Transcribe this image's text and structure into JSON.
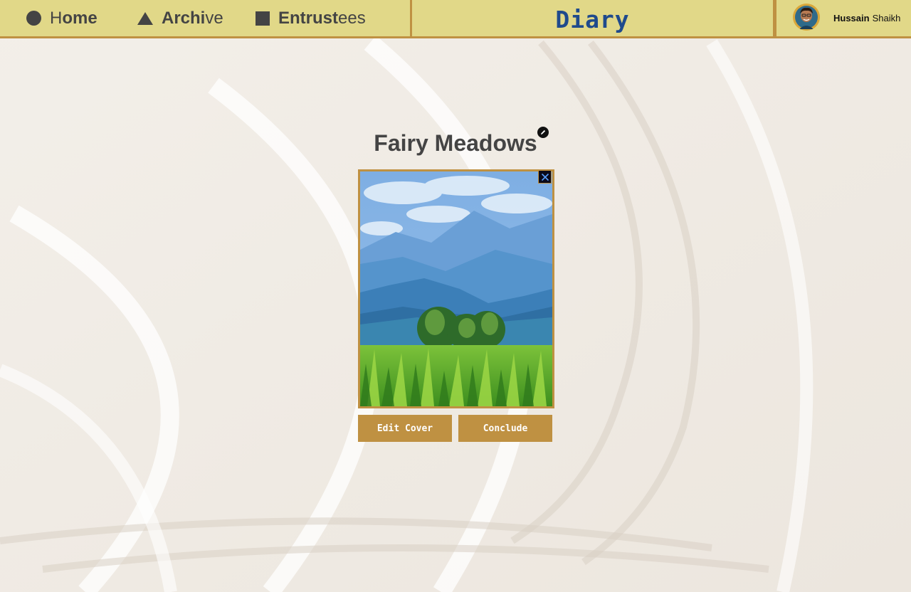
{
  "nav": {
    "home": {
      "prefix": "H",
      "bold": "ome",
      "rest": ""
    },
    "archive": {
      "bold": "Archi",
      "rest": "ve"
    },
    "entrustees": {
      "bold": "Entrust",
      "rest": "ees"
    }
  },
  "brand": "Diary",
  "user": {
    "first_name": "Hussain",
    "last_name": "Shaikh"
  },
  "diary": {
    "title": "Fairy Meadows",
    "buttons": {
      "edit_cover": "Edit Cover",
      "conclude": "Conclude"
    }
  },
  "icons": {
    "home": "circle-icon",
    "archive": "triangle-icon",
    "entrustees": "square-icon",
    "edit_title": "pencil-icon",
    "remove_cover": "close-icon"
  },
  "colors": {
    "topbar": "#e1d888",
    "accent": "#bf9142",
    "brand": "#1f4a8c",
    "text": "#444444"
  }
}
